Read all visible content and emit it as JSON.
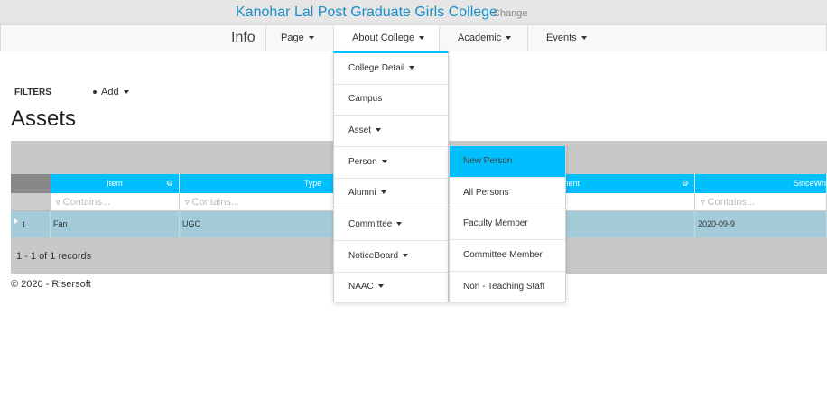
{
  "header": {
    "college_name": "Kanohar Lal Post Graduate Girls College",
    "change_label": "Change"
  },
  "nav": {
    "brand": "Info",
    "items": [
      {
        "label": "Page"
      },
      {
        "label": "About College"
      },
      {
        "label": "Academic"
      },
      {
        "label": "Events"
      }
    ]
  },
  "filters": {
    "label": "FILTERS",
    "add_label": "Add"
  },
  "page": {
    "title": "Assets"
  },
  "grid": {
    "columns": [
      {
        "header": "Item"
      },
      {
        "header": "Type"
      },
      {
        "header": "ment"
      },
      {
        "header": "SinceWh"
      }
    ],
    "filter_placeholder": "Contains...",
    "rows": [
      {
        "num": "1",
        "item": "Fan",
        "type": "UGC",
        "since": "2020-09-9"
      }
    ],
    "record_count": "1 - 1 of 1 records"
  },
  "dropdown": {
    "items": [
      {
        "label": "College Detail",
        "has_caret": true
      },
      {
        "label": "Campus",
        "has_caret": false
      },
      {
        "label": "Asset",
        "has_caret": true
      },
      {
        "label": "Person",
        "has_caret": true
      },
      {
        "label": "Alumni",
        "has_caret": true
      },
      {
        "label": "Committee",
        "has_caret": true
      },
      {
        "label": "NoticeBoard",
        "has_caret": true
      },
      {
        "label": "NAAC",
        "has_caret": true
      }
    ],
    "person_submenu": [
      {
        "label": "New Person",
        "active": true
      },
      {
        "label": "All Persons",
        "active": false
      },
      {
        "label": "Faculty Member",
        "active": false
      },
      {
        "label": "Committee Member",
        "active": false
      },
      {
        "label": "Non - Teaching Staff",
        "active": false
      }
    ]
  },
  "footer": {
    "text": "© 2020 - Risersoft"
  },
  "colors": {
    "accent": "#00bfff",
    "title_link": "#1a8fc6",
    "row_selected": "#a4ccd8"
  }
}
